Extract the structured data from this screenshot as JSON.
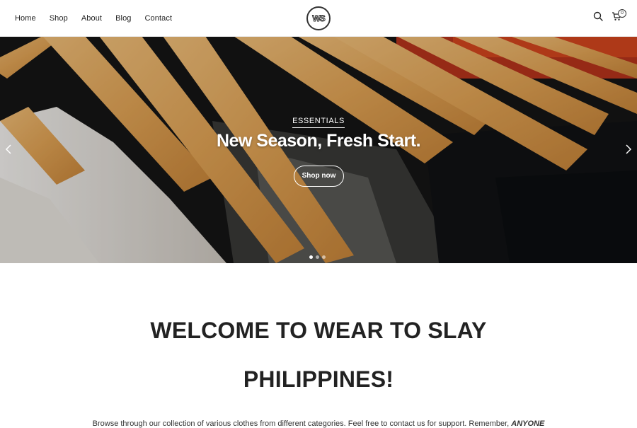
{
  "nav": {
    "items": [
      "Home",
      "Shop",
      "About",
      "Blog",
      "Contact"
    ]
  },
  "logo": {
    "text": "WS"
  },
  "cart": {
    "count": "0"
  },
  "hero": {
    "tag": "ESSENTIALS",
    "title": "New Season, Fresh Start.",
    "button": "Shop now",
    "slides": 3,
    "active_slide": 1
  },
  "welcome": {
    "line1": "WELCOME TO WEAR TO SLAY",
    "line2": "PHILIPPINES!",
    "intro": "Browse through our collection of various clothes from different categories. Feel free to contact us for support. Remember,",
    "intro_emphasis": "ANYONE"
  },
  "colors": {
    "text": "#222222",
    "hero_overlay_text": "#ffffff",
    "hanger_wood": "#e2a455"
  },
  "icons": {
    "search": "search-icon",
    "cart": "cart-icon",
    "prev": "chevron-left-icon",
    "next": "chevron-right-icon"
  }
}
